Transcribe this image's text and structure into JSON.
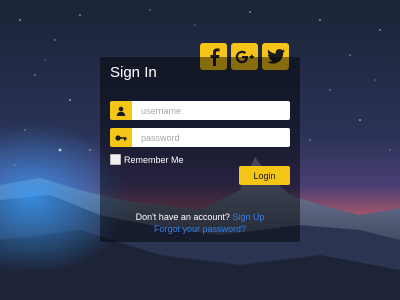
{
  "social": {
    "facebook_icon": "facebook-icon",
    "google_plus_icon": "google-plus-icon",
    "twitter_icon": "twitter-icon"
  },
  "form": {
    "title": "Sign In",
    "username_placeholder": "username",
    "username_value": "",
    "password_placeholder": "password",
    "password_value": "",
    "remember_label": "Remember Me",
    "login_label": "Login",
    "signup_prompt": "Don't have an account?",
    "signup_link": "Sign Up",
    "forgot_link": "Forgot your password?"
  },
  "colors": {
    "accent": "#f5c518",
    "link": "#2f80ed"
  }
}
